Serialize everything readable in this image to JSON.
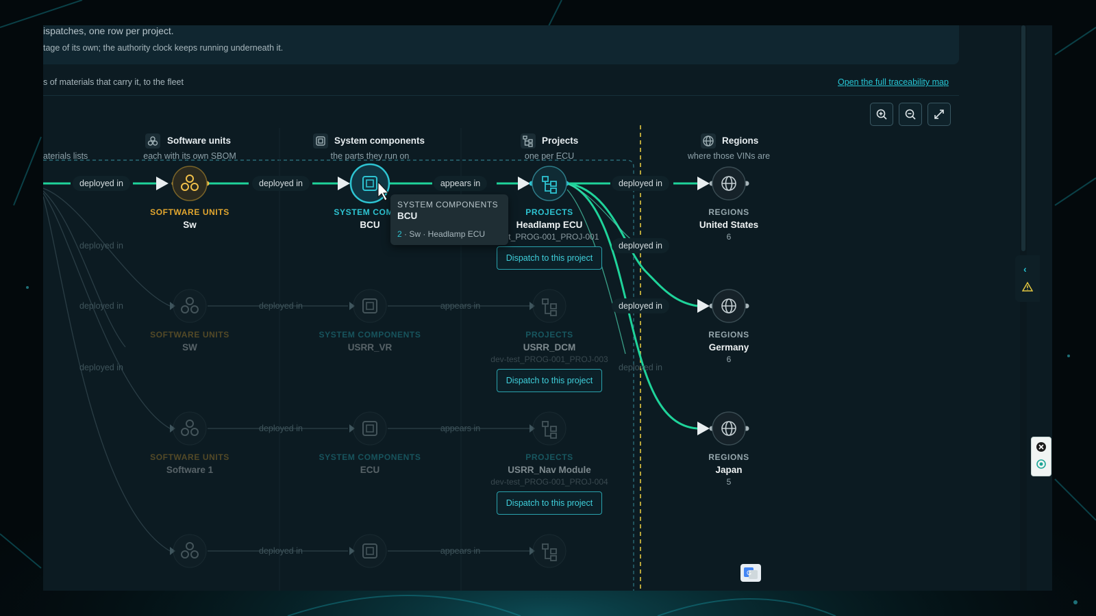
{
  "notice": {
    "line1": "ispatches, one row per project.",
    "line2": "tage of its own; the authority clock keeps running underneath it."
  },
  "subline": "s of materials that carry it, to the fleet",
  "map_link": "Open the full traceability map",
  "toolbar": {
    "zoom_in_icon": "zoom-in-icon",
    "zoom_out_icon": "zoom-out-icon",
    "fit_icon": "expand-icon"
  },
  "columns": {
    "materials": {
      "subtitle": "aterials lists"
    },
    "software": {
      "title": "Software units",
      "subtitle": "each with its own SBOM",
      "icon": "software-units-icon"
    },
    "system": {
      "title": "System components",
      "subtitle": "the parts they run on",
      "icon": "chip-icon"
    },
    "projects": {
      "title": "Projects",
      "subtitle": "one per ECU",
      "icon": "project-tree-icon"
    },
    "regions": {
      "title": "Regions",
      "subtitle": "where those VINs are",
      "icon": "globe-icon"
    }
  },
  "edge_labels": {
    "deployed_in": "deployed in",
    "appears_in": "appears in"
  },
  "rows": [
    {
      "software": {
        "category": "SOFTWARE UNITS",
        "name": "Sw"
      },
      "system": {
        "category": "SYSTEM COMPO",
        "name": "BCU"
      },
      "project": {
        "category": "PROJECTS",
        "name": "Headlamp ECU",
        "code": "est_PROG-001_PROJ-001",
        "dispatch": "Dispatch to this project"
      }
    },
    {
      "software": {
        "category": "SOFTWARE UNITS",
        "name": "SW"
      },
      "system": {
        "category": "SYSTEM COMPONENTS",
        "name": "USRR_VR"
      },
      "project": {
        "category": "PROJECTS",
        "name": "USRR_DCM",
        "code": "dev-test_PROG-001_PROJ-003",
        "dispatch": "Dispatch to this project"
      }
    },
    {
      "software": {
        "category": "SOFTWARE UNITS",
        "name": "Software 1"
      },
      "system": {
        "category": "SYSTEM COMPONENTS",
        "name": "ECU"
      },
      "project": {
        "category": "PROJECTS",
        "name": "USRR_Nav Module",
        "code": "dev-test_PROG-001_PROJ-004",
        "dispatch": "Dispatch to this project"
      }
    }
  ],
  "regions": [
    {
      "category": "REGIONS",
      "name": "United States",
      "count": "6"
    },
    {
      "category": "REGIONS",
      "name": "Germany",
      "count": "6"
    },
    {
      "category": "REGIONS",
      "name": "Japan",
      "count": "5"
    }
  ],
  "tooltip": {
    "category": "SYSTEM COMPONENTS",
    "name": "BCU",
    "relation_count": "2",
    "relation_text": " · Sw · Headlamp ECU"
  },
  "colors": {
    "accent": "#27c5d4",
    "active_edge": "#1fd39a",
    "software": "#e3a72f",
    "timeline": "#e2c640"
  }
}
